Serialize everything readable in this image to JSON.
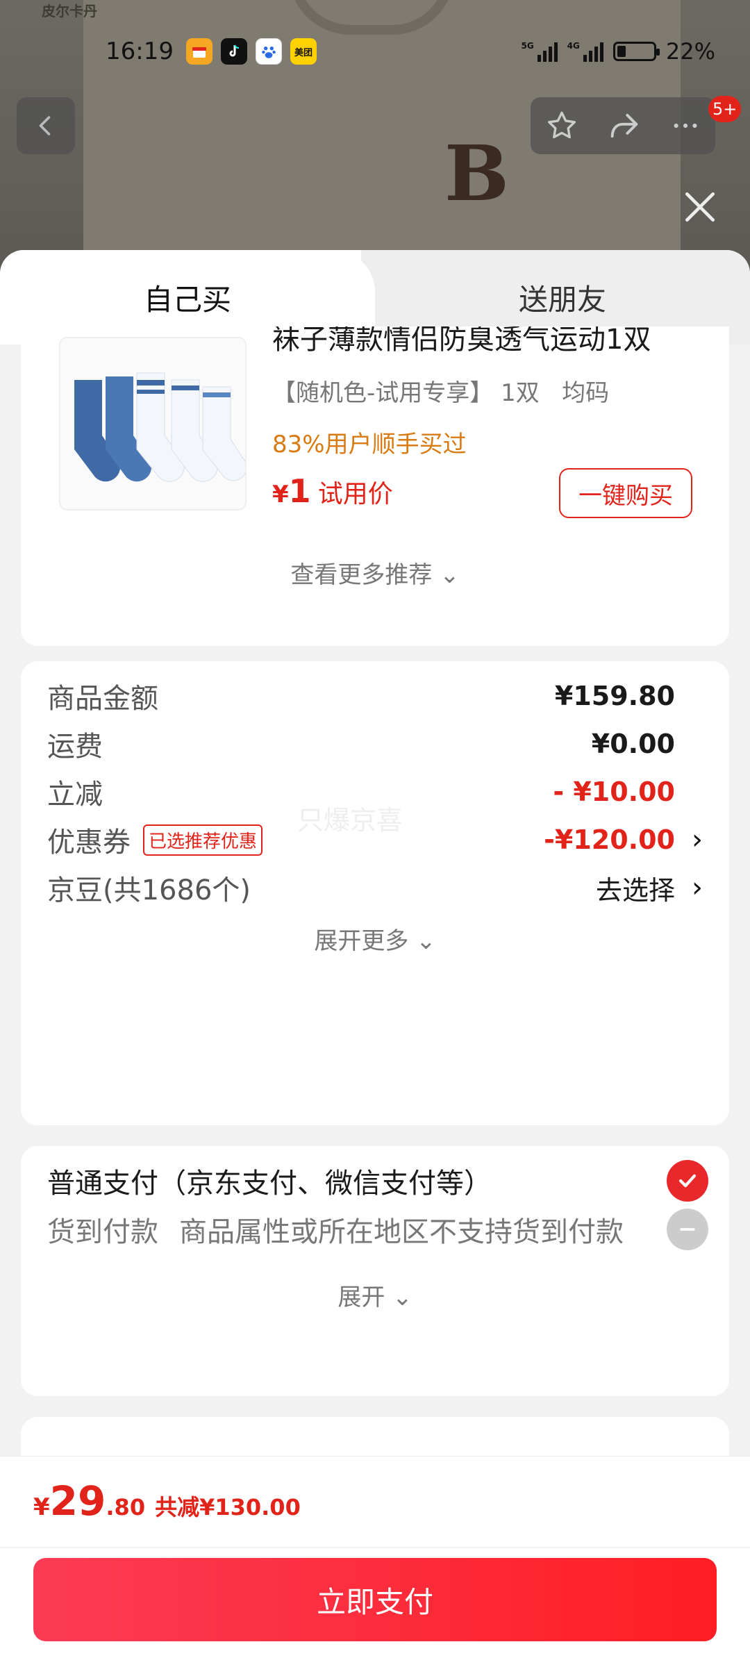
{
  "background": {
    "brand_mark": "皮尔卡丹",
    "logo_letter": "B"
  },
  "status_bar": {
    "time": "16:19",
    "apps": [
      {
        "name": "gift-app-icon",
        "color": "#f5a623"
      },
      {
        "name": "douyin-app-icon",
        "color": "#111111"
      },
      {
        "name": "baidu-app-icon",
        "color": "#2a6be5"
      },
      {
        "name": "meituan-app-icon",
        "color": "#ffd100",
        "text": "美团"
      }
    ],
    "signal1_label": "5G",
    "signal2_label": "4G",
    "battery": "22%"
  },
  "nav": {
    "badge": "5+"
  },
  "tabs": {
    "self_buy": "自己买",
    "gift_friend": "送朋友"
  },
  "recommend": {
    "title": "袜子薄款情侣防臭透气运动1双",
    "spec": "【随机色-试用专享】 1双   均码",
    "bought": "83%用户顺手买过",
    "currency": "¥",
    "price": "1",
    "price_label": "试用价",
    "buy_button": "一键购买",
    "more": "查看更多推荐 ⌄"
  },
  "summary": {
    "rows": [
      {
        "label": "商品金额",
        "value": "¥159.80"
      },
      {
        "label": "运费",
        "value": "¥0.00"
      },
      {
        "label": "立减",
        "value": "- ¥10.00"
      },
      {
        "label": "优惠券",
        "tag": "已选推荐优惠",
        "value": "-¥120.00"
      },
      {
        "label": "京豆(共1686个)",
        "value": "去选择"
      }
    ],
    "watermark": "只爆京喜",
    "expand": "展开更多 ⌄"
  },
  "payment": {
    "normal": "普通支付（京东支付、微信支付等）",
    "cod_label": "货到付款",
    "cod_note": "商品属性或所在地区不支持货到付款",
    "expand": "展开 ⌄"
  },
  "bottom": {
    "currency": "¥",
    "total_int": "29",
    "total_dec": ".80",
    "saved": "共减¥130.00",
    "pay_button": "立即支付"
  },
  "colors": {
    "accent_red": "#e2231a",
    "orange": "#d97a12"
  }
}
